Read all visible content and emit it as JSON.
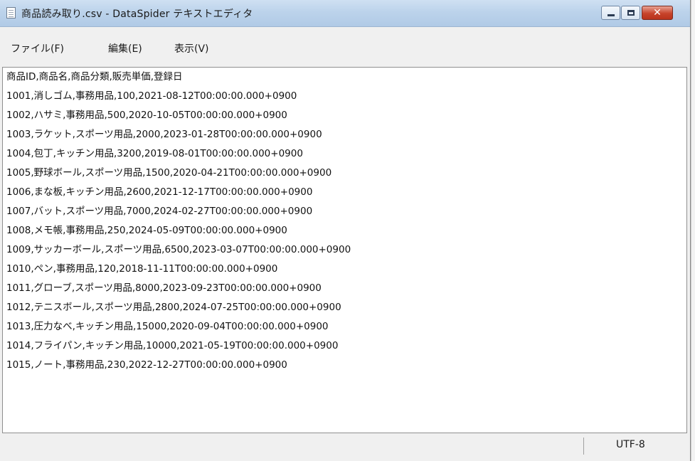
{
  "window": {
    "title": "商品読み取り.csv - DataSpider テキストエディタ",
    "icon": "document-icon",
    "controls": {
      "close_glyph": "✕"
    }
  },
  "menu": {
    "file": "ファイル(F)",
    "edit": "編集(E)",
    "view": "表示(V)"
  },
  "content": {
    "lines": [
      "商品ID,商品名,商品分類,販売単価,登録日",
      "1001,消しゴム,事務用品,100,2021-08-12T00:00:00.000+0900",
      "1002,ハサミ,事務用品,500,2020-10-05T00:00:00.000+0900",
      "1003,ラケット,スポーツ用品,2000,2023-01-28T00:00:00.000+0900",
      "1004,包丁,キッチン用品,3200,2019-08-01T00:00:00.000+0900",
      "1005,野球ボール,スポーツ用品,1500,2020-04-21T00:00:00.000+0900",
      "1006,まな板,キッチン用品,2600,2021-12-17T00:00:00.000+0900",
      "1007,バット,スポーツ用品,7000,2024-02-27T00:00:00.000+0900",
      "1008,メモ帳,事務用品,250,2024-05-09T00:00:00.000+0900",
      "1009,サッカーボール,スポーツ用品,6500,2023-03-07T00:00:00.000+0900",
      "1010,ペン,事務用品,120,2018-11-11T00:00:00.000+0900",
      "1011,グローブ,スポーツ用品,8000,2023-09-23T00:00:00.000+0900",
      "1012,テニスボール,スポーツ用品,2800,2024-07-25T00:00:00.000+0900",
      "1013,圧力なべ,キッチン用品,15000,2020-09-04T00:00:00.000+0900",
      "1014,フライパン,キッチン用品,10000,2021-05-19T00:00:00.000+0900",
      "1015,ノート,事務用品,230,2022-12-27T00:00:00.000+0900"
    ]
  },
  "status": {
    "encoding": "UTF-8"
  },
  "colors": {
    "titlebar": "#bcd3eb",
    "close_button": "#c7442b",
    "chrome": "#f0f0f0",
    "editor_background": "#ffffff"
  }
}
